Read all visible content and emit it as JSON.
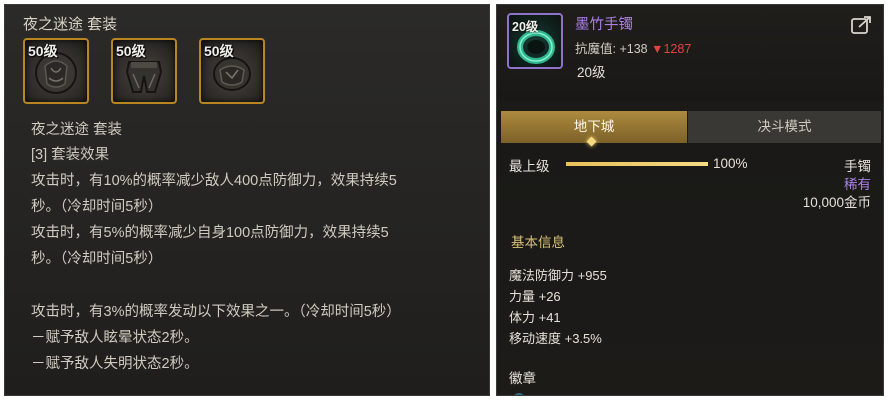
{
  "left": {
    "title": "夜之迷途  套装",
    "slots": [
      {
        "level": "50级"
      },
      {
        "level": "50级"
      },
      {
        "level": "50级"
      }
    ],
    "lines": [
      "夜之迷途 套装",
      "[3] 套装效果",
      "攻击时，有10%的概率减少敌人400点防御力，效果持续5",
      "秒。（冷却时间5秒）",
      "攻击时，有5%的概率减少自身100点防御力，效果持续5",
      "秒。（冷却时间5秒）",
      "攻击时，有3%的概率发动以下效果之一。（冷却时间5秒）",
      "－赋予敌人眩晕状态2秒。",
      "－赋予敌人失明状态2秒。"
    ]
  },
  "right": {
    "icon_level": "20级",
    "item_name": "墨竹手镯",
    "resist_label": "抗魔值: +138",
    "resist_delta": "▼1287",
    "item_level": "20级",
    "tabs": [
      "地下城",
      "决斗模式"
    ],
    "upgrade_label": "最上级",
    "progress": 1.0,
    "progress_text": "100%",
    "item_type": "手镯",
    "item_rarity": "稀有",
    "price": "10,000金币",
    "basic_info_title": "基本信息",
    "stats": [
      "魔法防御力 +955",
      "力量 +26",
      "体力 +41",
      "移动速度 +3.5%"
    ],
    "badge_title": "徽章"
  },
  "colors": {
    "slot_border": "#b8861f",
    "rare_purple": "#a97ee9",
    "decrease_red": "#e0443f",
    "tab_gold": "#ad8a3e",
    "progress_gold": "#e8c15a"
  }
}
